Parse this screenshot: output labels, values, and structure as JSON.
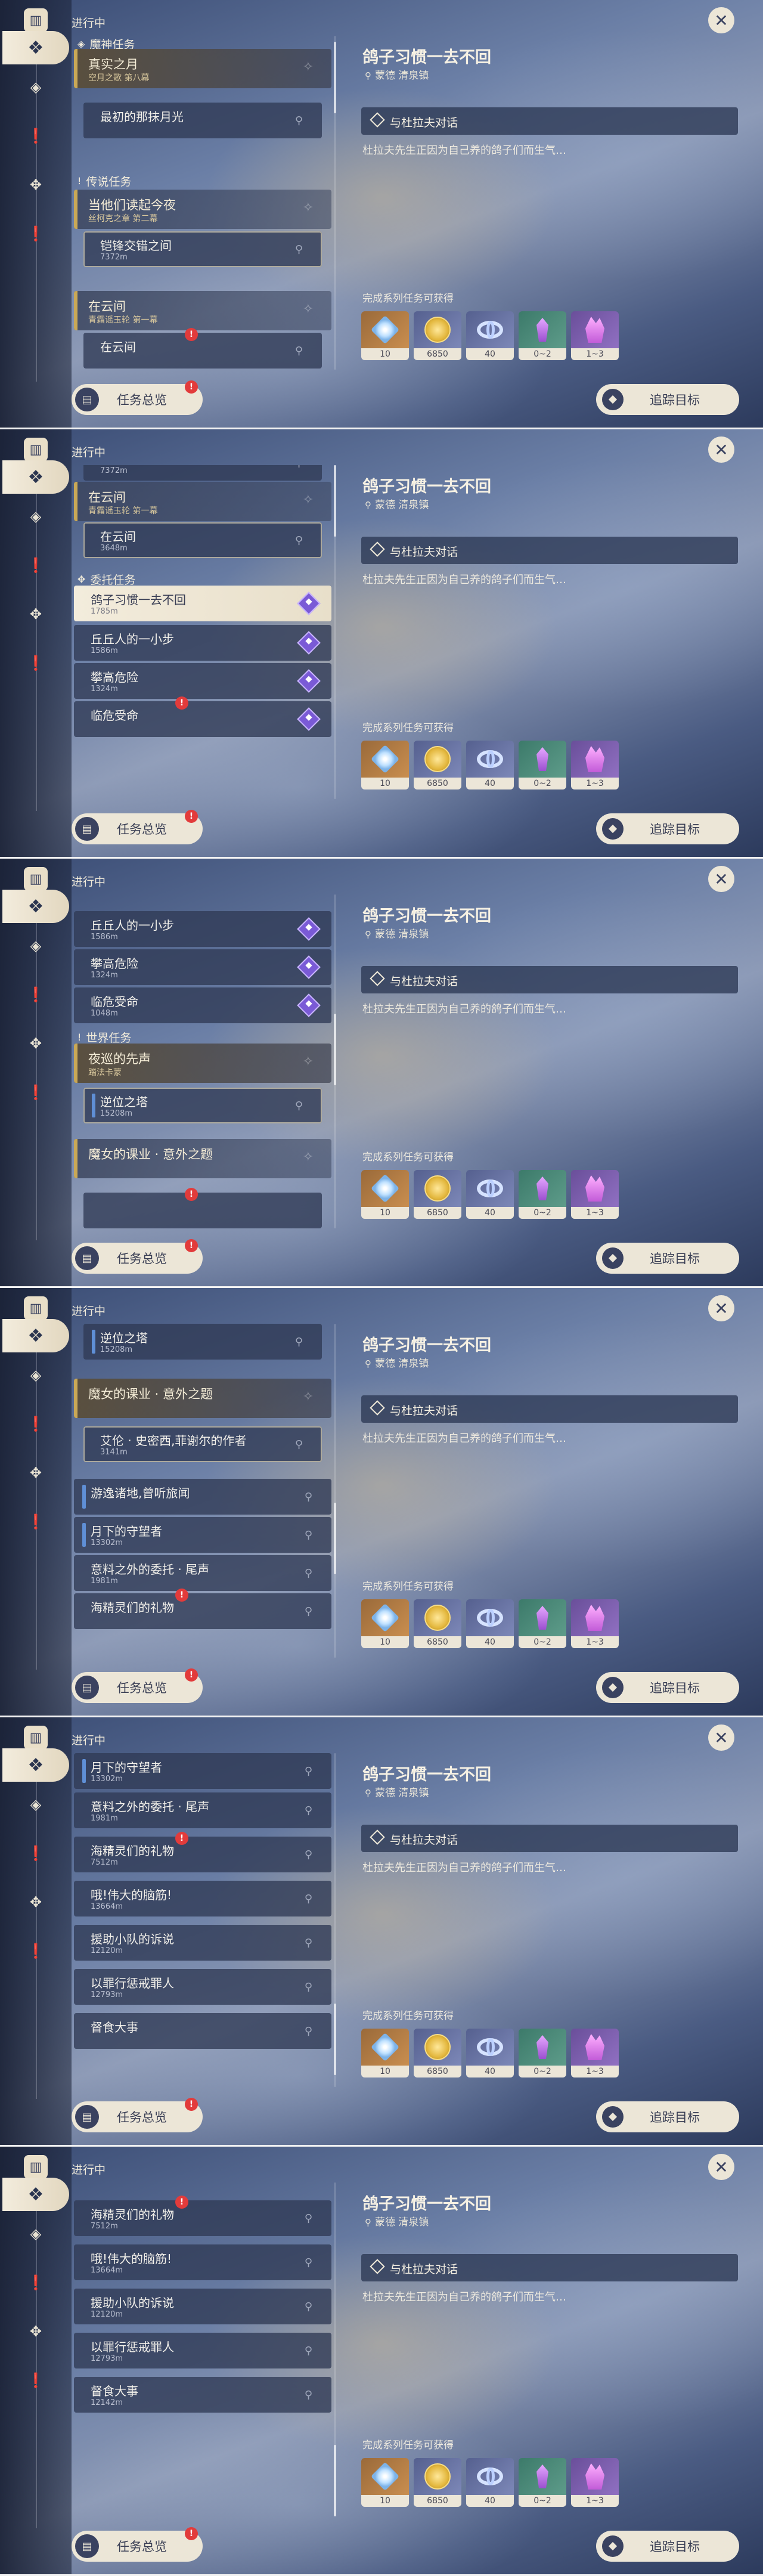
{
  "status_label": "进行中",
  "rail": {
    "book_icon": "book-icon",
    "items": [
      "world-quest-icon",
      "archon-icon",
      "exclamation-icon",
      "commission-icon",
      "exclamation-icon"
    ]
  },
  "quests": {
    "group_archon": "魔神任务",
    "group_legend": "传说任务",
    "group_commission": "委托任务",
    "group_world": "世界任务",
    "true_moon": {
      "title": "真实之月",
      "sub": "空月之歌 第八幕"
    },
    "last_moonlight": {
      "title": "最初的那抹月光"
    },
    "night_drunk": {
      "title": "当他们读起今夜",
      "sub": "丝柯克之章 第二幕"
    },
    "blade_sky": {
      "title": "铠锋交错之间",
      "dist": "7372m"
    },
    "in_clouds": {
      "title": "在云间",
      "sub": "青霜谣玉轮 第一幕"
    },
    "in_clouds_sub": {
      "title": "在云间",
      "dist": "3648m"
    },
    "pigeon": {
      "title": "鸽子习惯一去不回",
      "dist": "1785m"
    },
    "small_step": {
      "title": "丘丘人的一小步",
      "dist": "1586m"
    },
    "climb": {
      "title": "攀高危险",
      "dist": "1324m"
    },
    "mission": {
      "title": "临危受命",
      "dist": "1048m"
    },
    "night_patrol": {
      "title": "夜巡的先声",
      "sub": "踏法卡蒙"
    },
    "reverse_tower": {
      "title": "逆位之塔",
      "dist": "15208m"
    },
    "witch": {
      "title": "魔女的课业 · 意外之题"
    },
    "author": {
      "title": "艾伦 · 史密西,菲谢尔的作者",
      "dist": "3141m"
    },
    "wander": {
      "title": "游逸诸地,曾听旅闻"
    },
    "moon_guard": {
      "title": "月下的守望者",
      "dist": "13302m"
    },
    "unexpected": {
      "title": "意料之外的委托 · 尾声",
      "dist": "1981m"
    },
    "sea_gift": {
      "title": "海精灵们的礼物",
      "dist": "7512m"
    },
    "great_brain": {
      "title": "哦!伟大的脑筋!",
      "dist": "13664m"
    },
    "rescue": {
      "title": "援助小队的诉说",
      "dist": "12120m"
    },
    "warning": {
      "title": "以罪行惩戒罪人",
      "dist": "12793m"
    },
    "feast": {
      "title": "督食大事",
      "dist": "12142m"
    }
  },
  "detail": {
    "title": "鸽子习惯一去不回",
    "location": "蒙德 清泉镇",
    "objective": "与杜拉夫对话",
    "description": "杜拉夫先生正因为自己养的鸽子们而生气…",
    "rewards_title": "完成系列任务可获得",
    "rewards": [
      {
        "icon": "primogem-icon",
        "value": "10"
      },
      {
        "icon": "mora-icon",
        "value": "6850"
      },
      {
        "icon": "adventure-exp-icon",
        "value": "40"
      },
      {
        "icon": "crystal-icon",
        "value": "0~2"
      },
      {
        "icon": "crystal-cluster-icon",
        "value": "1~3"
      }
    ]
  },
  "buttons": {
    "overview": "任务总览",
    "track": "追踪目标",
    "badge": "!"
  },
  "colors": {
    "accent_gold": "#c9a857",
    "button_bg": "#ece6d7",
    "badge_red": "#e23b3b",
    "commission_purple": "#7a5ad6",
    "progress_blue": "#5f8fd6"
  }
}
